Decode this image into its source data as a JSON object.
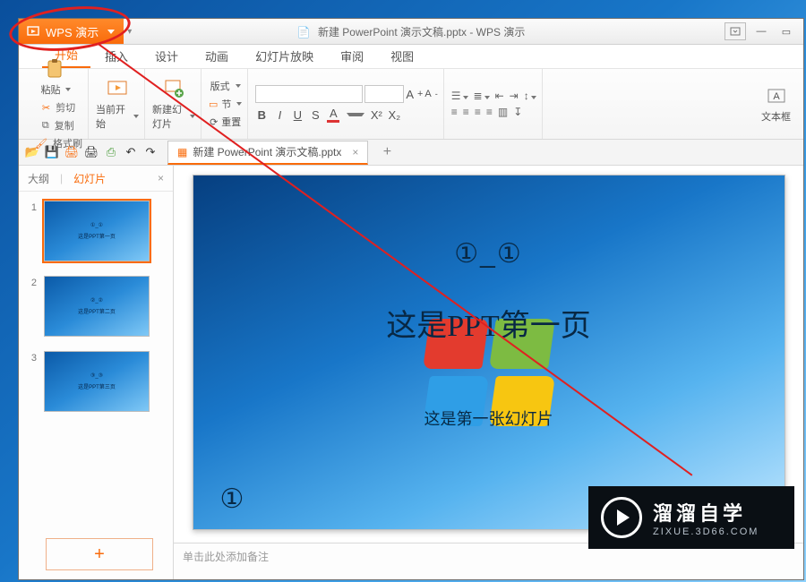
{
  "titlebar": {
    "app_button": "WPS 演示",
    "doc_title": "新建 PowerPoint 演示文稿.pptx - WPS 演示"
  },
  "menu": {
    "tabs": [
      "开始",
      "插入",
      "设计",
      "动画",
      "幻灯片放映",
      "审阅",
      "视图"
    ],
    "active_index": 0
  },
  "ribbon": {
    "paste": "粘贴",
    "cut": "剪切",
    "copy": "复制",
    "format_painter": "格式刷",
    "from_current": "当前开始",
    "new_slide": "新建幻灯片",
    "layout": "版式",
    "section": "节",
    "reset": "重置",
    "font_name": "",
    "font_size": "",
    "textbox": "文本框"
  },
  "docbar": {
    "tab_label": "新建 PowerPoint 演示文稿.pptx"
  },
  "sidebar": {
    "tab_outline": "大纲",
    "tab_slides": "幻灯片",
    "slides": [
      {
        "n": "1",
        "line1": "①_①",
        "line2": "这是PPT第一页"
      },
      {
        "n": "2",
        "line1": "②_②",
        "line2": "这是PPT第二页"
      },
      {
        "n": "3",
        "line1": "③_③",
        "line2": "这是PPT第三页"
      }
    ]
  },
  "slide": {
    "line1": "①_①",
    "line2": "这是PPT第一页",
    "line3": "这是第一张幻灯片",
    "page_marker": "①"
  },
  "notes": {
    "placeholder": "单击此处添加备注"
  },
  "watermark": {
    "line1": "溜溜自学",
    "line2": "ZIXUE.3D66.COM"
  }
}
